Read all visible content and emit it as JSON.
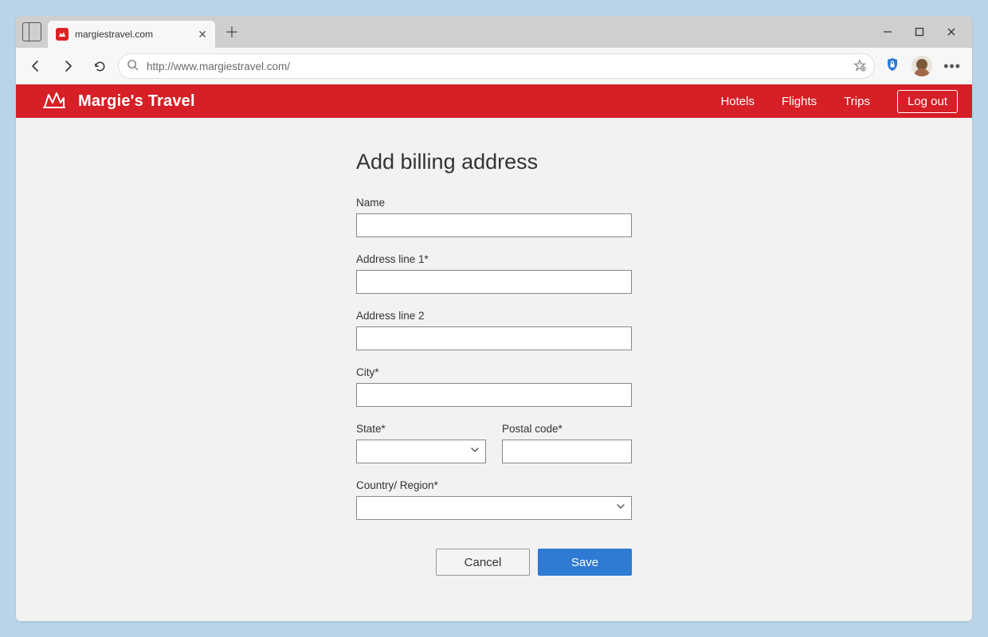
{
  "browser": {
    "tab_title": "margiestravel.com",
    "url": "http://www.margiestravel.com/"
  },
  "header": {
    "brand": "Margie's Travel",
    "nav": {
      "hotels": "Hotels",
      "flights": "Flights",
      "trips": "Trips"
    },
    "logout": "Log out"
  },
  "form": {
    "title": "Add billing address",
    "labels": {
      "name": "Name",
      "address1": "Address line 1*",
      "address2": "Address line 2",
      "city": "City*",
      "state": "State*",
      "postal": "Postal code*",
      "country": "Country/ Region*"
    },
    "values": {
      "name": "",
      "address1": "",
      "address2": "",
      "city": "",
      "state": "",
      "postal": "",
      "country": ""
    },
    "buttons": {
      "cancel": "Cancel",
      "save": "Save"
    }
  },
  "colors": {
    "brand": "#d61f26",
    "primary": "#2f7ad3"
  }
}
